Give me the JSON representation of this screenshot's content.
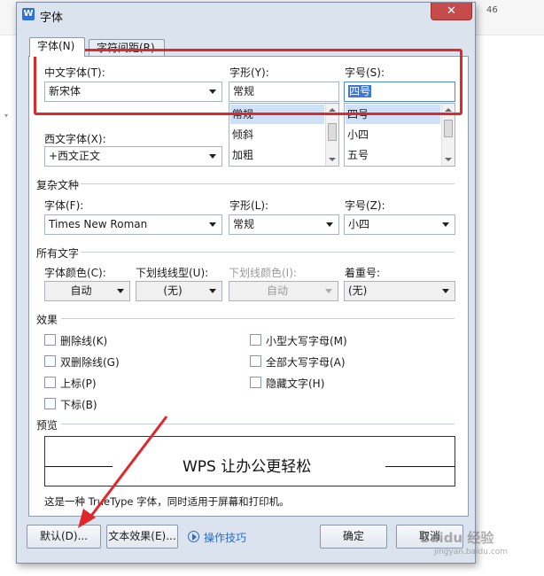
{
  "background": {
    "page_number": "46"
  },
  "dialog": {
    "title": "字体",
    "app_icon_letter": "W",
    "close_glyph": "✕"
  },
  "tabs": [
    {
      "label": "字体(N)",
      "active": true
    },
    {
      "label": "字符间距(R)",
      "active": false
    }
  ],
  "chinese_font": {
    "label": "中文字体(T):",
    "value": "新宋体"
  },
  "style": {
    "label": "字形(Y):",
    "value": "常规",
    "options": [
      "常规",
      "倾斜",
      "加粗"
    ]
  },
  "size": {
    "label": "字号(S):",
    "value": "四号",
    "options": [
      "四号",
      "小四",
      "五号"
    ]
  },
  "western_font": {
    "label": "西文字体(X):",
    "value": "+西文正文"
  },
  "complex": {
    "section_title": "复杂文种",
    "font_label": "字体(F):",
    "font_value": "Times New Roman",
    "style_label": "字形(L):",
    "style_value": "常规",
    "size_label": "字号(Z):",
    "size_value": "小四"
  },
  "all_text": {
    "section_title": "所有文字",
    "color_label": "字体颜色(C):",
    "color_value": "自动",
    "underline_type_label": "下划线线型(U):",
    "underline_type_value": "(无)",
    "underline_color_label": "下划线颜色(I):",
    "underline_color_value": "自动",
    "emphasis_label": "着重号:",
    "emphasis_value": "(无)"
  },
  "effects": {
    "section_title": "效果",
    "left": [
      {
        "label": "删除线(K)",
        "checked": false
      },
      {
        "label": "双删除线(G)",
        "checked": false
      },
      {
        "label": "上标(P)",
        "checked": false
      },
      {
        "label": "下标(B)",
        "checked": false
      }
    ],
    "right": [
      {
        "label": "小型大写字母(M)",
        "checked": false
      },
      {
        "label": "全部大写字母(A)",
        "checked": false
      },
      {
        "label": "隐藏文字(H)",
        "checked": false
      }
    ]
  },
  "preview": {
    "section_title": "预览",
    "text": "WPS 让办公更轻松",
    "note": "这是一种 TrueType 字体，同时适用于屏幕和打印机。"
  },
  "buttons": {
    "default": "默认(D)...",
    "text_effects": "文本效果(E)...",
    "tips": "操作技巧",
    "ok": "确定",
    "cancel": "取消"
  },
  "watermark": {
    "brand": "Baidu 经验",
    "url": "jingyan.baidu.com"
  },
  "colors": {
    "annotation_red": "#e0282c",
    "accent_blue": "#3b78d8",
    "link_blue": "#2a6acb"
  }
}
